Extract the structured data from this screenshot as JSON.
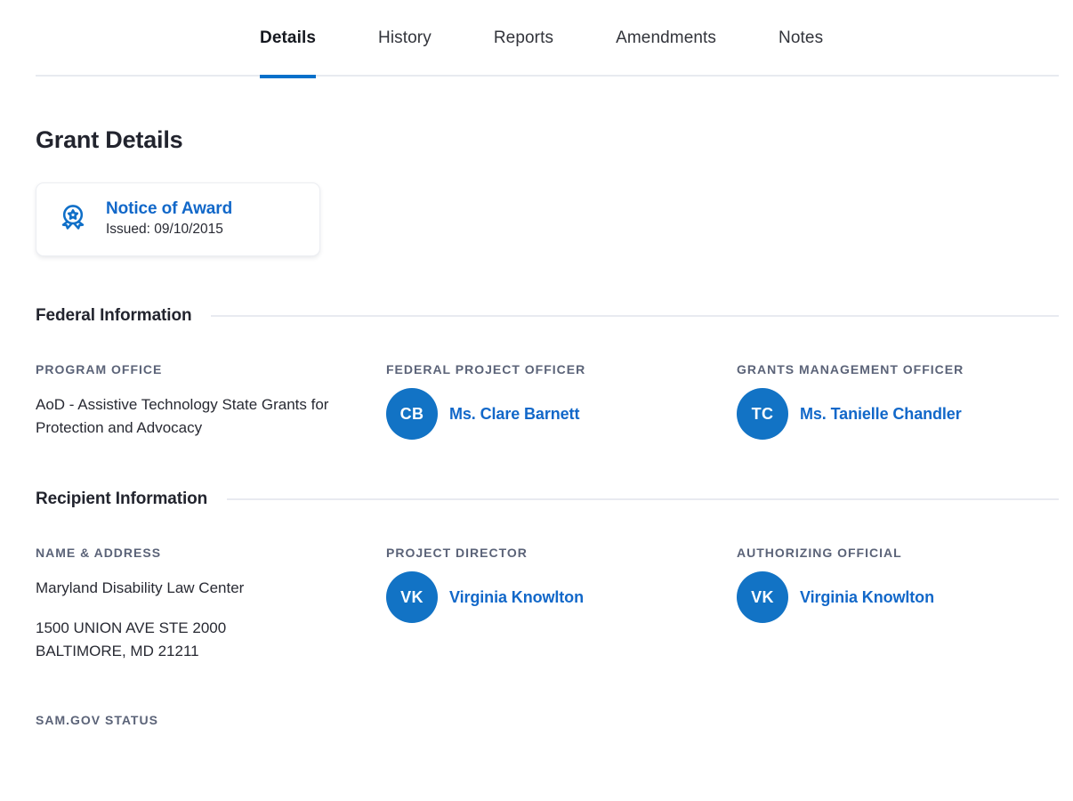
{
  "tabs": [
    {
      "label": "Details",
      "active": true
    },
    {
      "label": "History",
      "active": false
    },
    {
      "label": "Reports",
      "active": false
    },
    {
      "label": "Amendments",
      "active": false
    },
    {
      "label": "Notes",
      "active": false
    }
  ],
  "page_title": "Grant Details",
  "award_card": {
    "icon": "award-ribbon-icon",
    "title": "Notice of Award",
    "issued": "Issued: 09/10/2015"
  },
  "federal_information": {
    "heading": "Federal Information",
    "program_office": {
      "label": "PROGRAM OFFICE",
      "value": "AoD - Assistive Technology State Grants for Protection and Advocacy"
    },
    "project_officer": {
      "label": "FEDERAL PROJECT OFFICER",
      "initials": "CB",
      "name": "Ms. Clare Barnett"
    },
    "management_officer": {
      "label": "GRANTS MANAGEMENT OFFICER",
      "initials": "TC",
      "name": "Ms. Tanielle Chandler"
    }
  },
  "recipient_information": {
    "heading": "Recipient Information",
    "name_address": {
      "label": "NAME & ADDRESS",
      "org": "Maryland Disability Law Center",
      "street": "1500 UNION AVE STE 2000",
      "city_state_zip": "BALTIMORE, MD 21211"
    },
    "project_director": {
      "label": "PROJECT DIRECTOR",
      "initials": "VK",
      "name": "Virginia Knowlton"
    },
    "authorizing_official": {
      "label": "AUTHORIZING OFFICIAL",
      "initials": "VK",
      "name": "Virginia Knowlton"
    },
    "sam_gov_status_label": "SAM.GOV STATUS"
  },
  "colors": {
    "accent_blue": "#0470ca",
    "link_blue": "#1268c9",
    "avatar_blue": "#1273c5",
    "label_gray": "#5b6378",
    "text_dark": "#282a33",
    "rule_gray": "#e8eaf0"
  }
}
